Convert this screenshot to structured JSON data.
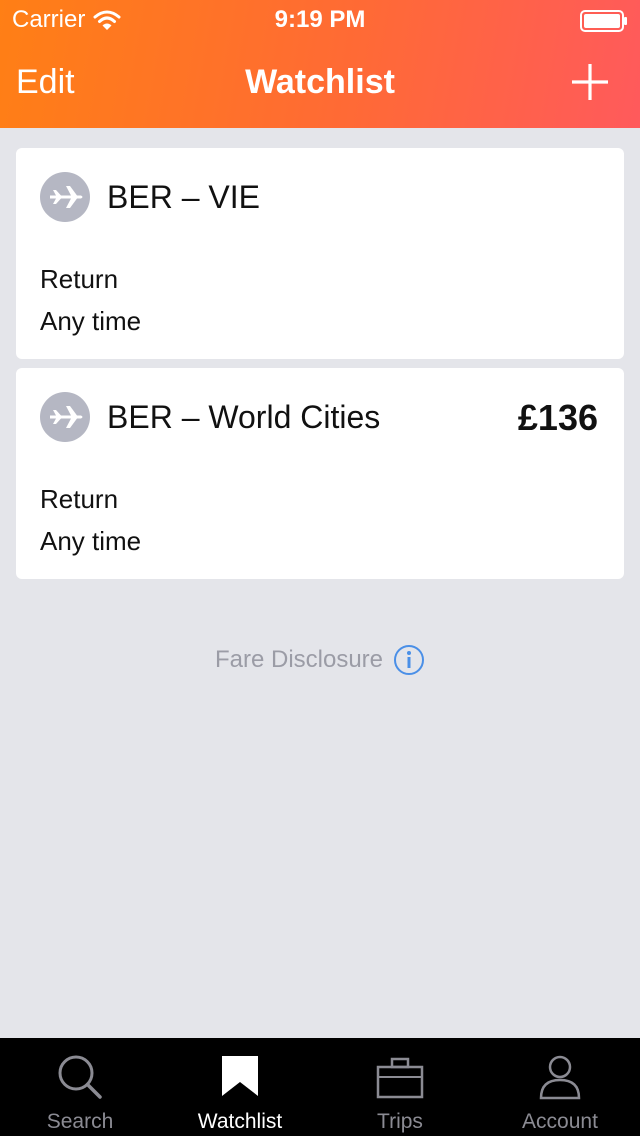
{
  "status_bar": {
    "carrier": "Carrier",
    "time": "9:19 PM"
  },
  "nav": {
    "edit_label": "Edit",
    "title": "Watchlist",
    "add_icon": "plus-icon"
  },
  "watchlist": [
    {
      "icon": "airplane-icon",
      "route": "BER – VIE",
      "price": "",
      "trip_type": "Return",
      "time": "Any time"
    },
    {
      "icon": "airplane-icon",
      "route": "BER – World Cities",
      "price": "£136",
      "trip_type": "Return",
      "time": "Any time"
    }
  ],
  "fare_disclosure": {
    "label": "Fare Disclosure",
    "icon": "info-icon"
  },
  "tabs": [
    {
      "label": "Search",
      "icon": "search-icon",
      "active": false
    },
    {
      "label": "Watchlist",
      "icon": "bookmark-icon",
      "active": true
    },
    {
      "label": "Trips",
      "icon": "briefcase-icon",
      "active": false
    },
    {
      "label": "Account",
      "icon": "person-icon",
      "active": false
    }
  ],
  "colors": {
    "header_gradient_start": "#ff7f15",
    "header_gradient_end": "#ff5a5c",
    "background": "#e4e5ea",
    "tab_bar": "#000000",
    "info_blue": "#4a8fe7"
  }
}
